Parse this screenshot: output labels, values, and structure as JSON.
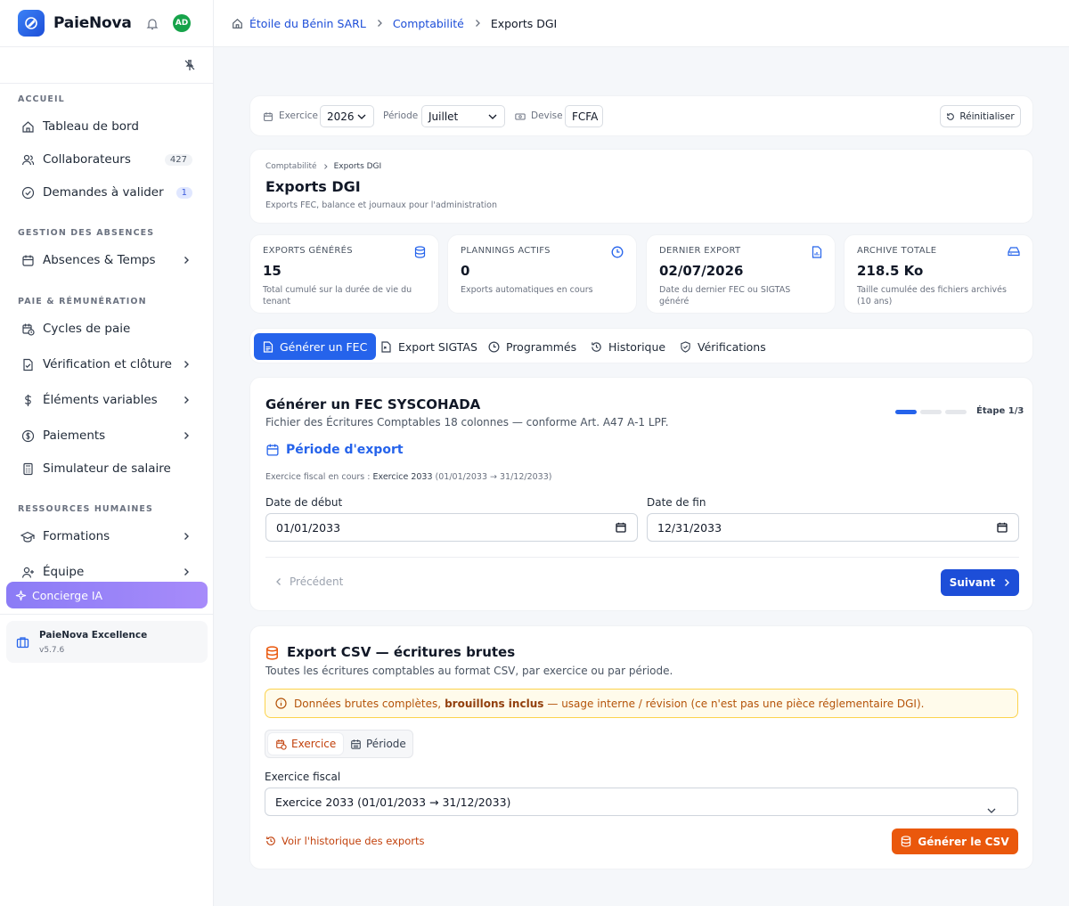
{
  "app": {
    "name": "PaieNova",
    "avatar_initials": "AD"
  },
  "sidebar": {
    "sections": [
      {
        "title": "ACCUEIL"
      },
      {
        "title": "GESTION DES ABSENCES"
      },
      {
        "title": "PAIE & RÉMUNÉRATION"
      },
      {
        "title": "RESSOURCES HUMAINES"
      }
    ],
    "items": [
      {
        "label": "Tableau de bord",
        "icon": "home-icon"
      },
      {
        "label": "Collaborateurs",
        "icon": "users-icon",
        "badge": "427"
      },
      {
        "label": "Demandes à valider",
        "icon": "check-circle-icon",
        "badge": "1"
      },
      {
        "label": "Absences & Temps",
        "icon": "calendar-icon"
      },
      {
        "label": "Cycles de paie",
        "icon": "calendar-clock-icon"
      },
      {
        "label": "Vérification et clôture",
        "icon": "file-check-icon"
      },
      {
        "label": "Éléments variables",
        "icon": "dollar-icon"
      },
      {
        "label": "Paiements",
        "icon": "coin-icon"
      },
      {
        "label": "Simulateur de salaire",
        "icon": "calculator-icon"
      },
      {
        "label": "Formations",
        "icon": "graduation-cap-icon"
      },
      {
        "label": "Équipe",
        "icon": "user-plus-icon"
      }
    ],
    "concierge": "Concierge IA",
    "footer": {
      "title": "PaieNova Excellence",
      "version": "v5.7.6"
    }
  },
  "breadcrumb": {
    "company": "Étoile du Bénin SARL",
    "section": "Comptabilité",
    "current": "Exports DGI"
  },
  "filters": {
    "exercice_label": "Exercice",
    "exercice_value": "2026",
    "periode_label": "Période",
    "periode_value": "Juillet",
    "devise_label": "Devise",
    "devise_value": "FCFA",
    "reset_label": "Réinitialiser"
  },
  "header": {
    "crumb_parent": "Comptabilité",
    "crumb_current": "Exports DGI",
    "title": "Exports DGI",
    "subtitle": "Exports FEC, balance et journaux pour l'administration"
  },
  "stats": [
    {
      "label": "EXPORTS GÉNÉRÉS",
      "value": "15",
      "desc": "Total cumulé sur la durée de vie du tenant"
    },
    {
      "label": "PLANNINGS ACTIFS",
      "value": "0",
      "desc": "Exports automatiques en cours"
    },
    {
      "label": "DERNIER EXPORT",
      "value": "02/07/2026",
      "desc": "Date du dernier FEC ou SIGTAS généré"
    },
    {
      "label": "ARCHIVE TOTALE",
      "value": "218.5 Ko",
      "desc": "Taille cumulée des fichiers archivés (10 ans)"
    }
  ],
  "tabs": [
    {
      "label": "Générer un FEC"
    },
    {
      "label": "Export SIGTAS"
    },
    {
      "label": "Programmés"
    },
    {
      "label": "Historique"
    },
    {
      "label": "Vérifications"
    }
  ],
  "fec": {
    "title": "Générer un FEC SYSCOHADA",
    "subtitle": "Fichier des Écritures Comptables 18 colonnes — conforme Art. A47 A-1 LPF.",
    "step_label": "Étape 1/3",
    "step_current": 1,
    "step_total": 3,
    "section_title": "Période d'export",
    "fiscal_prefix": "Exercice fiscal en cours : ",
    "fiscal_name": "Exercice 2033",
    "fiscal_range": " (01/01/2033 → 31/12/2033)",
    "start_label": "Date de début",
    "start_value": "01/01/2033",
    "end_label": "Date de fin",
    "end_value": "12/31/2033",
    "prev_label": "Précédent",
    "next_label": "Suivant"
  },
  "csv": {
    "title": "Export CSV — écritures brutes",
    "subtitle": "Toutes les écritures comptables au format CSV, par exercice ou par période.",
    "alert_pre": "Données brutes complètes,",
    "alert_bold": "brouillons inclus",
    "alert_post": "— usage interne / révision (ce n'est pas une pièce réglementaire DGI).",
    "seg_exercice": "Exercice",
    "seg_periode": "Période",
    "field_label": "Exercice fiscal",
    "field_value": "Exercice 2033 (01/01/2033 → 31/12/2033)",
    "history_link": "Voir l'historique des exports",
    "generate_label": "Générer le CSV"
  }
}
